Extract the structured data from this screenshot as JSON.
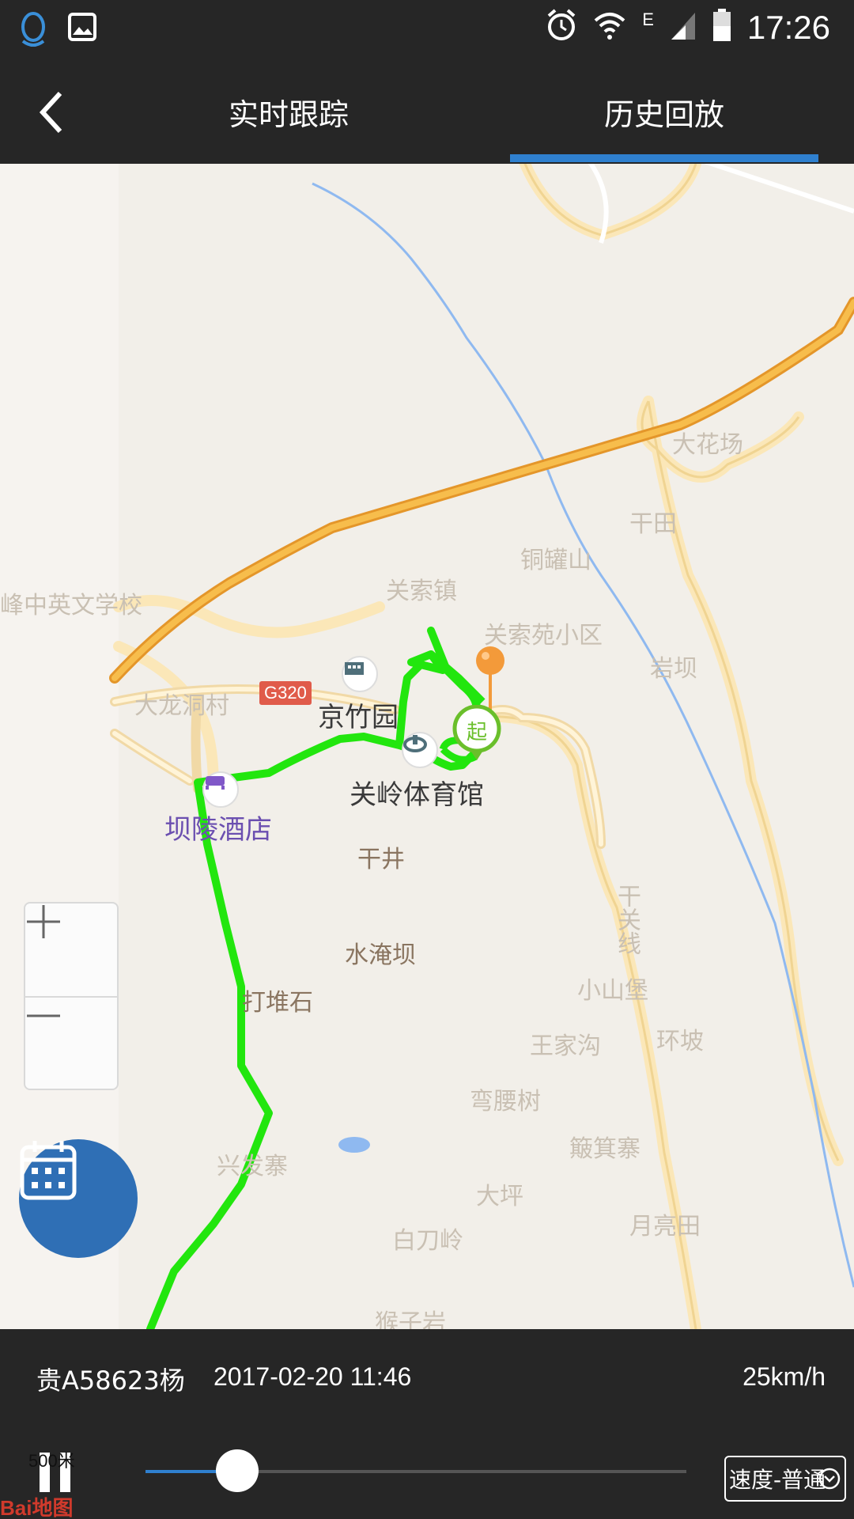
{
  "status_bar": {
    "time": "17:26",
    "network_label": "E",
    "icons": [
      "qq-icon",
      "image-icon",
      "alarm-icon",
      "wifi-icon",
      "signal-icon",
      "battery-icon"
    ]
  },
  "header": {
    "tabs": [
      {
        "label": "实时跟踪",
        "active": false
      },
      {
        "label": "历史回放",
        "active": true
      }
    ],
    "accent_color": "#2f80cf"
  },
  "map": {
    "labels": [
      {
        "text": "关索镇",
        "style": "faint"
      },
      {
        "text": "铜罐山",
        "style": "faint"
      },
      {
        "text": "关索苑小区",
        "style": "faint"
      },
      {
        "text": "干田",
        "style": "faint"
      },
      {
        "text": "大花场",
        "style": "faint"
      },
      {
        "text": "岩坝",
        "style": "faint"
      },
      {
        "text": "峰中英文学校",
        "style": "faint"
      },
      {
        "text": "大龙洞村",
        "style": "faint"
      },
      {
        "text": "京竹园",
        "style": "dark"
      },
      {
        "text": "关岭体育馆",
        "style": "dark"
      },
      {
        "text": "坝陵酒店",
        "style": "hotel"
      },
      {
        "text": "干井",
        "style": "brown"
      },
      {
        "text": "水淹坝",
        "style": "brown"
      },
      {
        "text": "打堆石",
        "style": "brown"
      },
      {
        "text": "兴发寨",
        "style": "faint"
      },
      {
        "text": "小山堡",
        "style": "faint"
      },
      {
        "text": "王家沟",
        "style": "faint"
      },
      {
        "text": "环坡",
        "style": "faint"
      },
      {
        "text": "弯腰树",
        "style": "faint"
      },
      {
        "text": "簸箕寨",
        "style": "faint"
      },
      {
        "text": "大坪",
        "style": "faint"
      },
      {
        "text": "白刀岭",
        "style": "faint"
      },
      {
        "text": "月亮田",
        "style": "faint"
      },
      {
        "text": "猴子岩",
        "style": "faint"
      },
      {
        "text": "干关线",
        "style": "faint"
      }
    ],
    "road_badge": "G320",
    "start_marker": "起",
    "route_color": "#22e60e",
    "highway_color": "#f2b13a",
    "river_color": "#8fb9f0"
  },
  "zoom": {
    "in_label": "+",
    "out_label": "—"
  },
  "playback": {
    "plate": "贵A58623杨",
    "datetime": "2017-02-20 11:46",
    "speed": "25km/h",
    "progress": 0.17,
    "speed_mode": "速度-普通"
  },
  "scale": "500米",
  "logo": "Bai地图"
}
